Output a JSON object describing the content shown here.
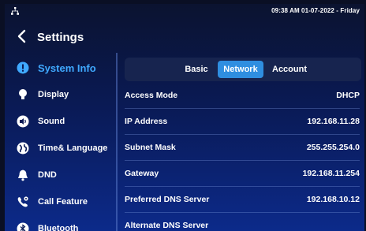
{
  "status": {
    "time_date": "09:38 AM  01-07-2022 - Friday",
    "network_icon": "network-icon"
  },
  "header": {
    "title": "Settings",
    "back_icon": "chevron-left-icon"
  },
  "sidebar": {
    "items": [
      {
        "label": "System Info",
        "icon": "info-icon",
        "active": true
      },
      {
        "label": "Display",
        "icon": "bulb-icon"
      },
      {
        "label": "Sound",
        "icon": "speaker-icon"
      },
      {
        "label": "Time& Language",
        "icon": "globe-icon"
      },
      {
        "label": "DND",
        "icon": "bell-icon"
      },
      {
        "label": "Call Feature",
        "icon": "phone-gear-icon"
      },
      {
        "label": "Bluetooth",
        "icon": "bluetooth-icon"
      }
    ]
  },
  "tabs": [
    {
      "label": "Basic"
    },
    {
      "label": "Network",
      "active": true
    },
    {
      "label": "Account"
    }
  ],
  "rows": [
    {
      "label": "Access Mode",
      "value": "DHCP"
    },
    {
      "label": "IP Address",
      "value": "192.168.11.28"
    },
    {
      "label": "Subnet Mask",
      "value": "255.255.254.0"
    },
    {
      "label": "Gateway",
      "value": "192.168.11.254"
    },
    {
      "label": "Preferred DNS Server",
      "value": "192.168.10.12"
    },
    {
      "label": "Alternate DNS Server",
      "value": ""
    }
  ],
  "colors": {
    "accent": "#3fa9ff",
    "active_tab": "#2f8ee0"
  }
}
